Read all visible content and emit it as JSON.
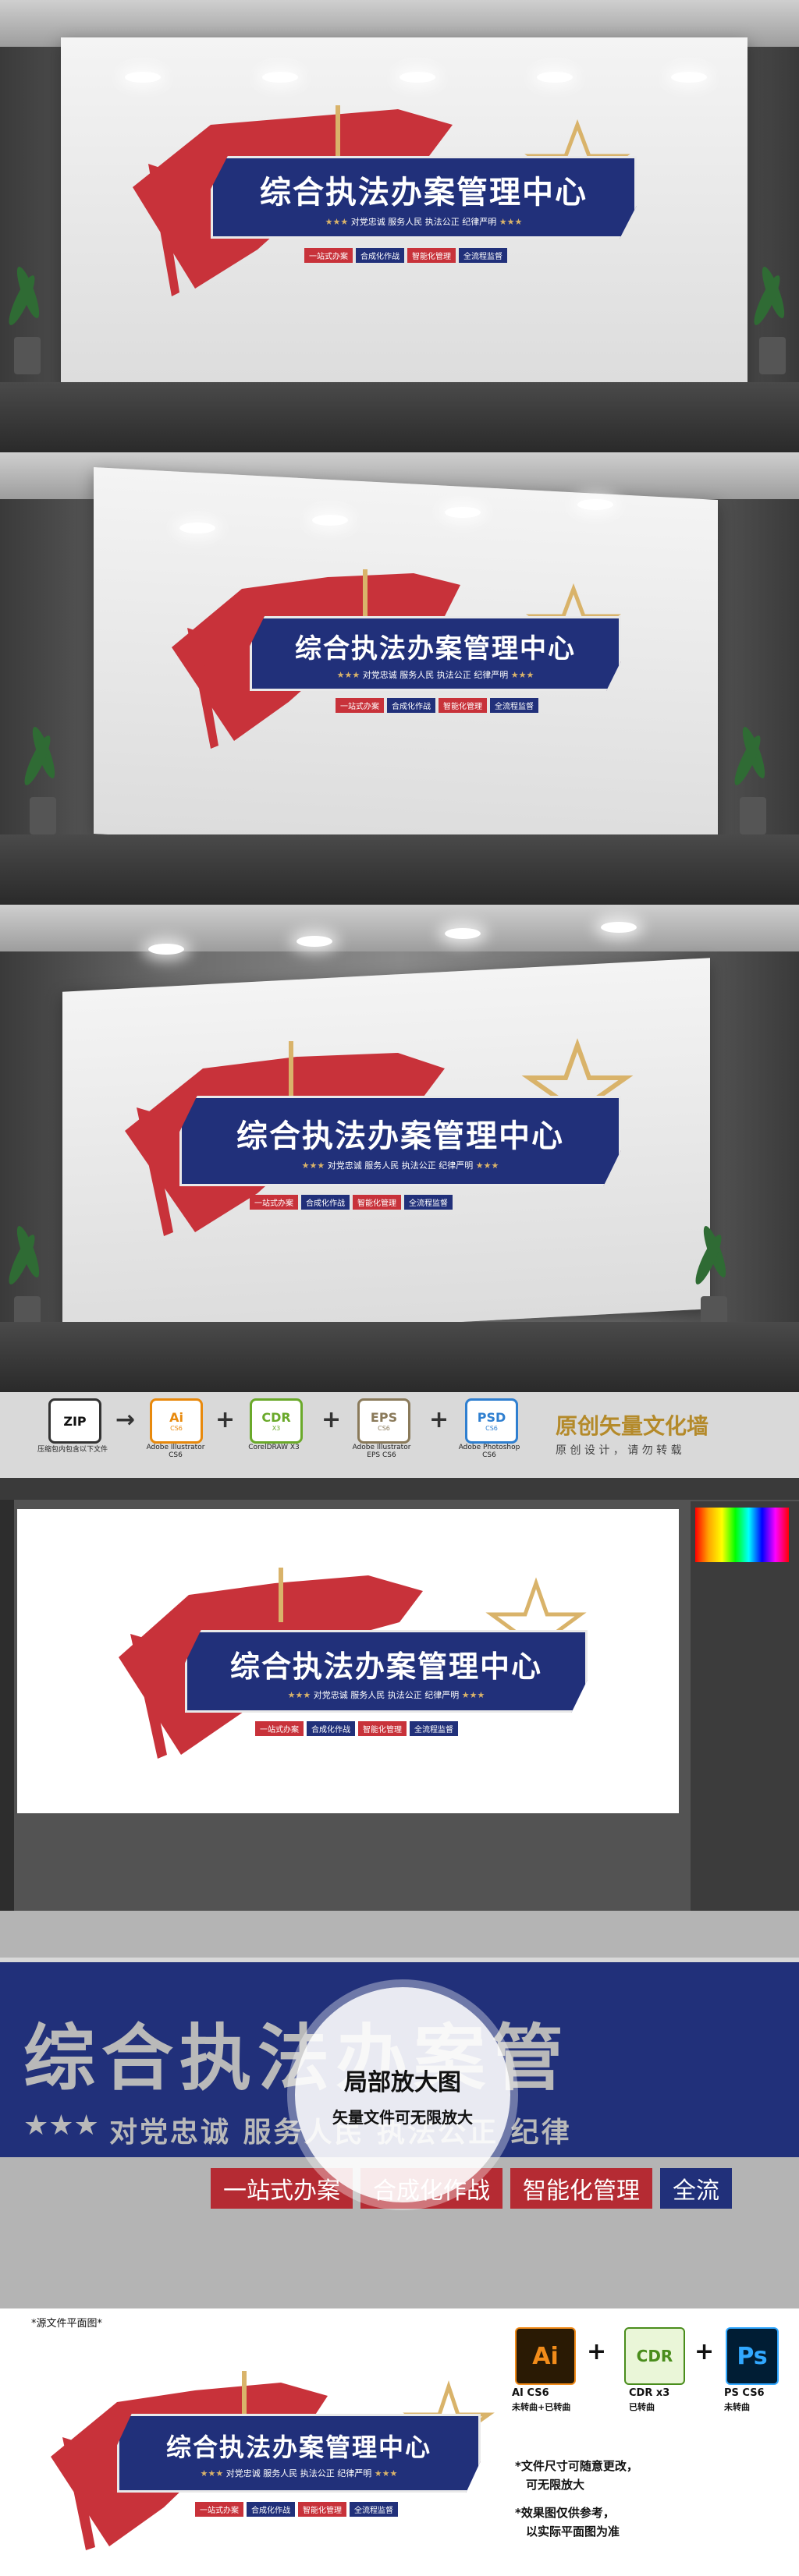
{
  "sign": {
    "title": "综合执法办案管理中心",
    "motto": "对党忠诚  服务人民  执法公正  纪律严明",
    "stars": "★★★",
    "tags": [
      "一站式办案",
      "合成化作战",
      "智能化管理",
      "全流程监督"
    ]
  },
  "strip": {
    "zip_label": "ZIP",
    "zip_caption": "压缩包内包含以下文件",
    "ai": {
      "label": "Ai",
      "ver": "CS6",
      "caption": "Adobe Illustrator CS6"
    },
    "cdr": {
      "label": "CDR",
      "ver": "X3",
      "caption": "CorelDRAW X3"
    },
    "eps": {
      "label": "EPS",
      "ver": "CS6",
      "caption": "Adobe Illustrator EPS CS6"
    },
    "psd": {
      "label": "PSD",
      "ver": "CS6",
      "caption": "Adobe Photoshop CS6"
    },
    "brand_title": "原创矢量文化墙",
    "brand_sub": "原 创 设 计 ， 请 勿 转 载"
  },
  "zoom": {
    "title": "综合执法办案管",
    "stars": "★★★",
    "motto": "对党忠诚  服务人民  执法公正  纪律",
    "tags": [
      "一站式办案",
      "合成化作战",
      "智能化管理",
      "全流"
    ],
    "circle_title": "局部放大图",
    "circle_sub": "矢量文件可无限放大"
  },
  "bottom": {
    "source_label": "*源文件平面图*",
    "ai_icon": "Ai",
    "cdr_icon": "CDR",
    "ps_icon": "Ps",
    "ai_cap1": "AI CS6",
    "ai_cap2": "未转曲+已转曲",
    "cdr_cap1": "CDR x3",
    "cdr_cap2": "已转曲",
    "ps_cap1": "PS CS6",
    "ps_cap2": "未转曲",
    "note1": "*文件尺寸可随意更改，",
    "note1b": "可无限放大",
    "note2": "*效果图仅供参考，",
    "note2b": "以实际平面图为准"
  },
  "colors": {
    "red": "#c8323a",
    "navy": "#21307a",
    "gold": "#d9b36a"
  }
}
